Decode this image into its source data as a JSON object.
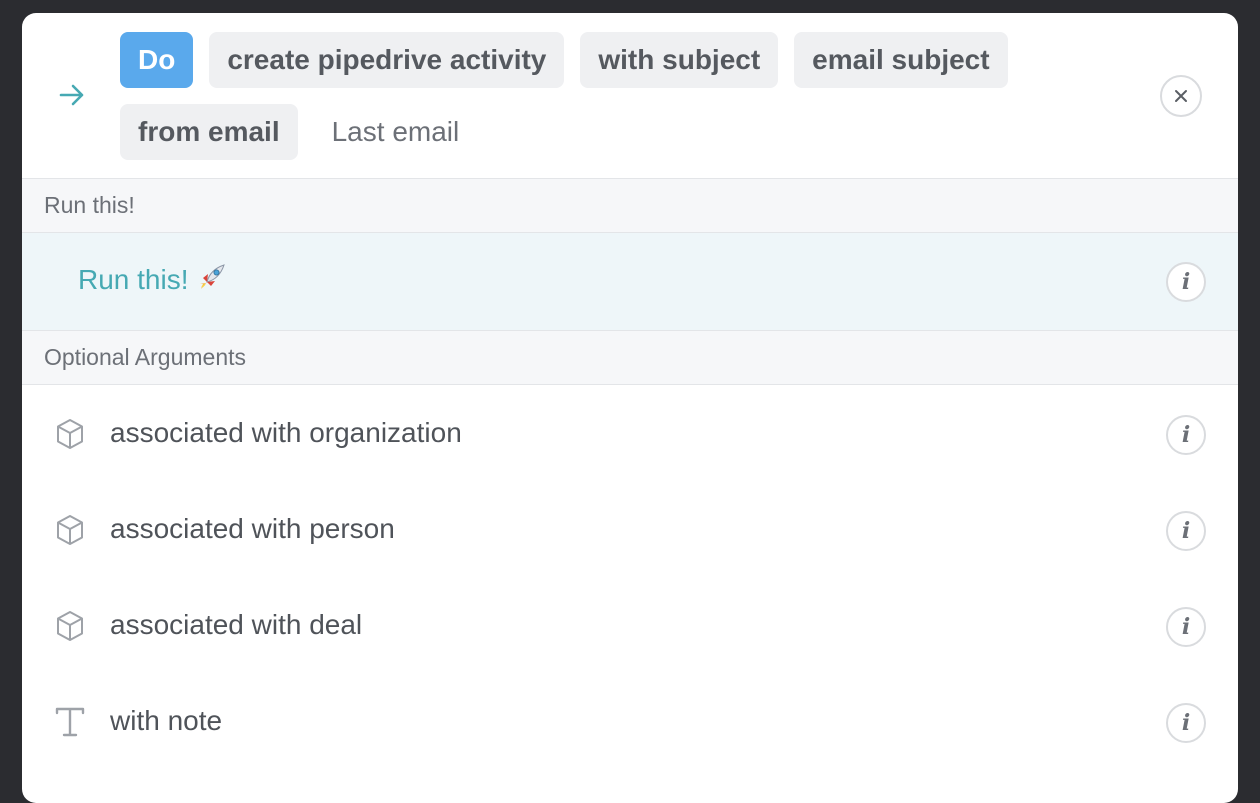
{
  "command": {
    "tokens": [
      {
        "label": "Do",
        "style": "primary"
      },
      {
        "label": "create pipedrive activity",
        "style": "chip"
      },
      {
        "label": "with subject",
        "style": "chip"
      },
      {
        "label": "email subject",
        "style": "chip"
      },
      {
        "label": "from email",
        "style": "chip"
      },
      {
        "label": "Last email",
        "style": "plain"
      }
    ],
    "arrow_icon": "arrow-right-icon",
    "close_icon": "close-icon"
  },
  "run_section": {
    "header": "Run this!",
    "action_label": "Run this!",
    "action_icon": "rocket-icon",
    "info_icon": "info-icon"
  },
  "optional_section": {
    "header": "Optional Arguments",
    "arguments": [
      {
        "label": "associated with organization",
        "icon": "cube-icon"
      },
      {
        "label": "associated with person",
        "icon": "cube-icon"
      },
      {
        "label": "associated with deal",
        "icon": "cube-icon"
      },
      {
        "label": "with note",
        "icon": "text-icon"
      }
    ]
  },
  "colors": {
    "accent_teal": "#46a9b3",
    "primary_blue": "#5aa9ec",
    "chip_bg": "#eff0f2",
    "run_row_bg": "#eef6f9",
    "backdrop": "#2b2c30"
  }
}
